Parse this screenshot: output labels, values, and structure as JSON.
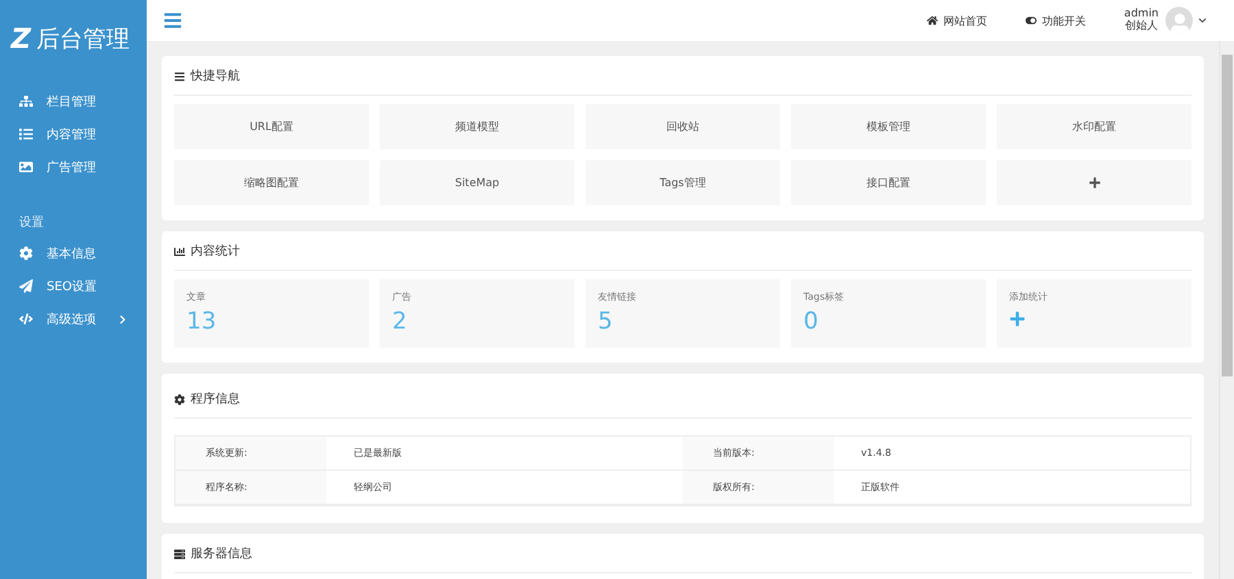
{
  "logo": {
    "mark": "Z",
    "title": "后台管理"
  },
  "sidebar": {
    "items": [
      {
        "label": "栏目管理"
      },
      {
        "label": "内容管理"
      },
      {
        "label": "广告管理"
      }
    ],
    "section": "设置",
    "settings": [
      {
        "label": "基本信息",
        "expandable": false
      },
      {
        "label": "SEO设置",
        "expandable": false
      },
      {
        "label": "高级选项",
        "expandable": true
      }
    ]
  },
  "topbar": {
    "links": [
      {
        "label": "网站首页"
      },
      {
        "label": "功能开关"
      }
    ],
    "user": {
      "name": "admin",
      "role": "创始人"
    }
  },
  "quick_nav": {
    "title": "快捷导航",
    "items": [
      {
        "kind": "text",
        "label": "URL配置"
      },
      {
        "kind": "text",
        "label": "频道模型"
      },
      {
        "kind": "text",
        "label": "回收站"
      },
      {
        "kind": "text",
        "label": "模板管理"
      },
      {
        "kind": "text",
        "label": "水印配置"
      },
      {
        "kind": "text",
        "label": "缩略图配置"
      },
      {
        "kind": "text",
        "label": "SiteMap"
      },
      {
        "kind": "text",
        "label": "Tags管理"
      },
      {
        "kind": "text",
        "label": "接口配置"
      },
      {
        "kind": "add"
      }
    ]
  },
  "stats": {
    "title": "内容统计",
    "items": [
      {
        "kind": "value",
        "label": "文章",
        "value": "13"
      },
      {
        "kind": "value",
        "label": "广告",
        "value": "2"
      },
      {
        "kind": "value",
        "label": "友情链接",
        "value": "5"
      },
      {
        "kind": "value",
        "label": "Tags标签",
        "value": "0"
      },
      {
        "kind": "add",
        "label": "添加统计"
      }
    ]
  },
  "program_info": {
    "title": "程序信息",
    "rows": [
      [
        "系统更新:",
        "已是最新版",
        "当前版本:",
        "v1.4.8"
      ],
      [
        "程序名称:",
        "轻纲公司",
        "版权所有:",
        "正版软件"
      ]
    ]
  },
  "server_info": {
    "title": "服务器信息"
  }
}
